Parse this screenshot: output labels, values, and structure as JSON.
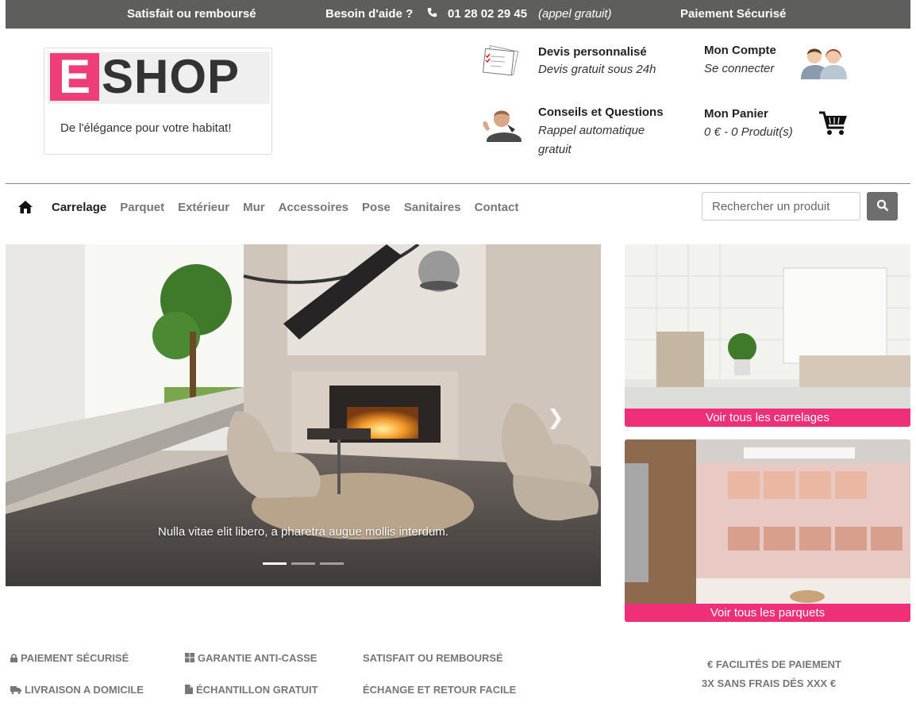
{
  "topbar": {
    "guarantee": "Satisfait ou remboursé",
    "help": "Besoin d'aide ?",
    "phone": "01 28 02 29 45",
    "phone_note": "(appel gratuit)",
    "secure": "Paiement Sécurisé"
  },
  "logo": {
    "letter": "E",
    "word": "SHOP",
    "tagline": "De l'élégance pour votre habitat!"
  },
  "header": {
    "quote": {
      "title": "Devis personnalisé",
      "sub": "Devis gratuit sous 24h",
      "icon": "quote-document-icon"
    },
    "advice": {
      "title": "Conseils et Questions",
      "sub": "Rappel automatique gratuit",
      "icon": "advisor-icon"
    },
    "account": {
      "title": "Mon Compte",
      "sub": "Se connecter",
      "icon": "users-icon"
    },
    "cart": {
      "title": "Mon Panier",
      "sub": "0 € - 0 Produit(s)",
      "icon": "cart-icon"
    }
  },
  "nav": {
    "items": [
      "Carrelage",
      "Parquet",
      "Extérieur",
      "Mur",
      "Accessoires",
      "Pose",
      "Sanitaires",
      "Contact"
    ],
    "active_index": 0
  },
  "search": {
    "placeholder": "Rechercher un produit"
  },
  "carousel": {
    "caption": "Nulla vitae elit libero, a pharetra augue mollis interdum.",
    "slides": 3,
    "active_slide": 0
  },
  "promos": [
    {
      "label": "Voir tous les carrelages"
    },
    {
      "label": "Voir tous les parquets"
    }
  ],
  "features": {
    "col1": [
      "PAIEMENT SÉCURISÉ",
      "LIVRAISON A DOMICILE"
    ],
    "col2": [
      "GARANTIE ANTI-CASSE",
      "ÉCHANTILLON GRATUIT"
    ],
    "col3": [
      "SATISFAIT OU REMBOURSÉ",
      "ÉCHANGE ET RETOUR FACILE"
    ],
    "col4": [
      "€ FACILITÉS DE PAIEMENT",
      "3X SANS FRAIS DÉS XXX €"
    ]
  },
  "colors": {
    "topbar": "#5e5f5d",
    "accent": "#ef2f78",
    "logo_e": "#ee3e7a"
  }
}
